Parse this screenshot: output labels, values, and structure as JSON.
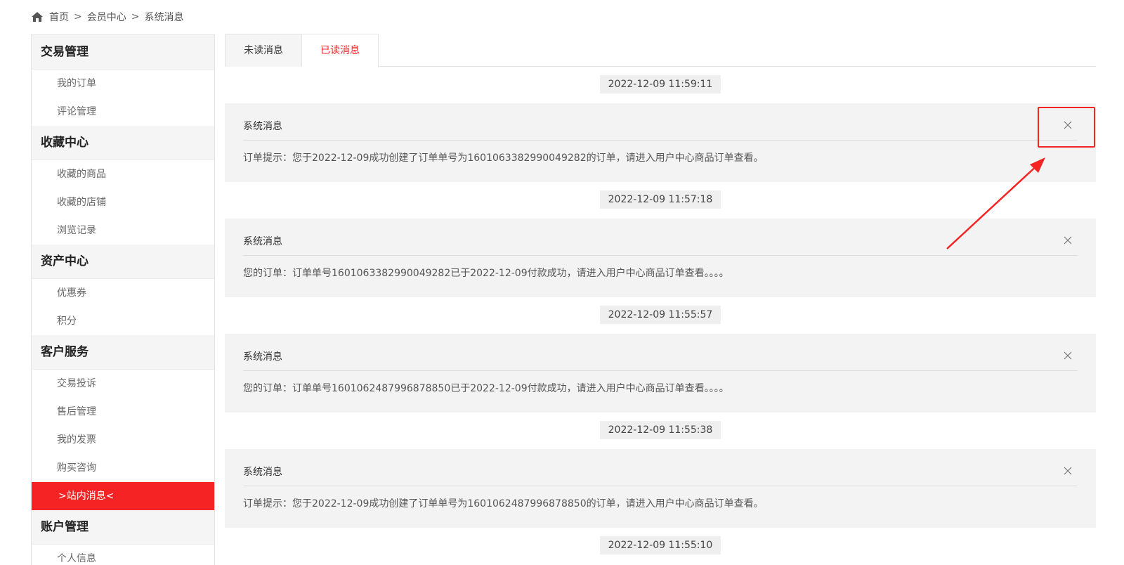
{
  "breadcrumb": {
    "home_icon": "home-icon",
    "items": [
      "首页",
      "会员中心",
      "系统消息"
    ],
    "separator": ">"
  },
  "sidebar": {
    "groups": [
      {
        "title": "交易管理",
        "items": [
          "我的订单",
          "评论管理"
        ]
      },
      {
        "title": "收藏中心",
        "items": [
          "收藏的商品",
          "收藏的店铺",
          "浏览记录"
        ]
      },
      {
        "title": "资产中心",
        "items": [
          "优惠券",
          "积分"
        ]
      },
      {
        "title": "客户服务",
        "items": [
          "交易投诉",
          "售后管理",
          "我的发票",
          "购买咨询",
          ">站内消息<"
        ]
      },
      {
        "title": "账户管理",
        "items": [
          "个人信息"
        ]
      }
    ],
    "active_item": ">站内消息<",
    "accent_color": "#f52323"
  },
  "tabs": {
    "items": [
      "未读消息",
      "已读消息"
    ],
    "active": "已读消息"
  },
  "messages": [
    {
      "time": "2022-12-09 11:59:11",
      "title": "系统消息",
      "body": "订单提示：您于2022-12-09成功创建了订单单号为1601063382990049282的订单，请进入用户中心商品订单查看。"
    },
    {
      "time": "2022-12-09 11:57:18",
      "title": "系统消息",
      "body": "您的订单：订单单号1601063382990049282已于2022-12-09付款成功，请进入用户中心商品订单查看。。。。"
    },
    {
      "time": "2022-12-09 11:55:57",
      "title": "系统消息",
      "body": "您的订单：订单单号1601062487996878850已于2022-12-09付款成功，请进入用户中心商品订单查看。。。。"
    },
    {
      "time": "2022-12-09 11:55:38",
      "title": "系统消息",
      "body": "订单提示：您于2022-12-09成功创建了订单单号为1601062487996878850的订单，请进入用户中心商品订单查看。"
    }
  ],
  "trailing_time": "2022-12-09 11:55:10",
  "close_icon": "close-icon"
}
